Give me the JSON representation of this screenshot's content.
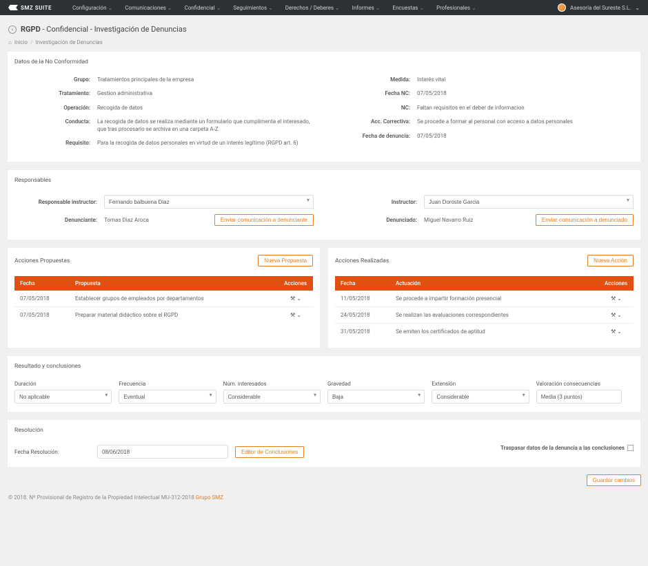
{
  "topbar": {
    "brand": "SMZ SUITE",
    "nav": [
      "Configuración",
      "Comunicaciones",
      "Confidencial",
      "Seguimientos",
      "Derechos / Deberes",
      "Informes",
      "Encuestas",
      "Profesionales"
    ],
    "user": "Asesoría del Sureste S.L."
  },
  "page": {
    "title_strong": "RGPD",
    "title_rest": "- Confidencial - Investigación de Denuncias"
  },
  "breadcrumb": {
    "home": "Inicio",
    "current": "Investigación de Denuncias"
  },
  "noConformidad": {
    "title": "Datos de la No Conformidad",
    "grupo_label": "Grupo:",
    "grupo": "Tratamientos principales de la empresa",
    "tratamiento_label": "Tratamiento:",
    "tratamiento": "Gestion administrativa",
    "operacion_label": "Operación:",
    "operacion": "Recogida de datos",
    "conducta_label": "Conducta:",
    "conducta": "La recogida de datos se realiza mediante un formulario que cumplimenta el interesado, que tras procesarlo se archiva en una carpeta A-Z",
    "requisito_label": "Requisito:",
    "requisito": "Para la recogida de datos personales en virtud de un interés legítimo (RGPD art. 6)",
    "medida_label": "Medida:",
    "medida": "Interés vital",
    "fechaNC_label": "Fecha NC:",
    "fechaNC": "07/05/2018",
    "nc_label": "NC:",
    "nc": "Faltan requisitos en el deber de informacion",
    "accCorrectiva_label": "Acc. Correctiva:",
    "accCorrectiva": "Se procede a formar al personal con acceso a datos personales",
    "fechaDenuncia_label": "Fecha de denuncia:",
    "fechaDenuncia": "07/05/2018"
  },
  "responsables": {
    "title": "Responsables",
    "respInstructor_label": "Responsable instructor:",
    "respInstructor": "Fernando balbuena Diaz",
    "denunciante_label": "Denunciante:",
    "denunciante": "Tomas Diaz Aroca",
    "btnDenunciante": "Enviar comunicación a denunciante",
    "instructor_label": "Instructor:",
    "instructor": "Juan Doroste Garcia",
    "denunciado_label": "Denunciado:",
    "denunciado": "Miguel Navarro Ruiz",
    "btnDenunciado": "Enviar comunicación a denunciado"
  },
  "propuestas": {
    "title": "Acciones Propuestas",
    "newBtn": "Nueva Propuesta",
    "headers": {
      "fecha": "Fecha",
      "propuesta": "Propuesta",
      "acciones": "Acciones"
    },
    "rows": [
      {
        "fecha": "07/05/2018",
        "propuesta": "Establecer grupos de empleados por departamentos"
      },
      {
        "fecha": "07/05/2018",
        "propuesta": "Preparar material didáctico sobre el RGPD"
      }
    ]
  },
  "realizadas": {
    "title": "Acciones Realizadas",
    "newBtn": "Nueva Acción",
    "headers": {
      "fecha": "Fecha",
      "actuacion": "Actuación",
      "acciones": "Acciones"
    },
    "rows": [
      {
        "fecha": "11/05/2018",
        "actuacion": "Se procede a impartir formación presencial"
      },
      {
        "fecha": "24/05/2018",
        "actuacion": "Se realizan las evaluaciones correspondientes"
      },
      {
        "fecha": "31/05/2018",
        "actuacion": "Se emiten los certificados de aptitud"
      }
    ]
  },
  "resultado": {
    "title": "Resultado y conclusiones",
    "duracion_label": "Duración",
    "duracion": "No aplicable",
    "frecuencia_label": "Frecuencia",
    "frecuencia": "Eventual",
    "numInteresados_label": "Núm. interesados",
    "numInteresados": "Considerable",
    "gravedad_label": "Gravedad",
    "gravedad": "Baja",
    "extension_label": "Extensión",
    "extension": "Considerable",
    "valoracion_label": "Valoración consecuencias",
    "valoracion": "Media (3 puntos)"
  },
  "resolucion": {
    "title": "Resolución",
    "fecha_label": "Fecha Resolución:",
    "fecha": "08/06/2018",
    "editorBtn": "Editor de Conclusiones",
    "transferText": "Traspasar datos de la denuncia a las conclusiones"
  },
  "saveBtn": "Guardar cambios",
  "footer": {
    "text": "© 2018. Nº Provisional de Registro de la Propiedad Intelectual MU-312-2018 ",
    "link": "Grupo SMZ"
  }
}
